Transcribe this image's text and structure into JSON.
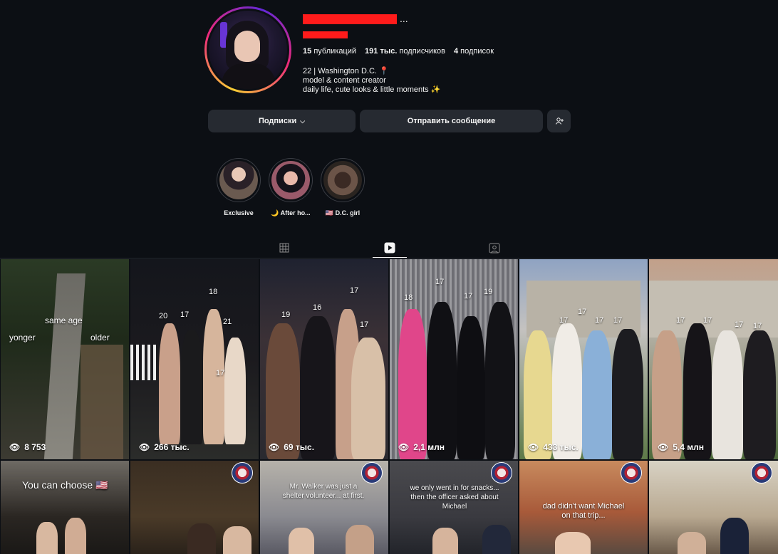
{
  "profile": {
    "username_suffix": "...",
    "stats": {
      "posts_count": "15",
      "posts_label": "публикаций",
      "followers_count": "191 тыс.",
      "followers_label": "подписчиков",
      "following_count": "4",
      "following_label": "подписок"
    },
    "bio": [
      "22 | Washington D.C. 📍",
      "model & content creator",
      "daily life, cute looks & little moments ✨"
    ]
  },
  "buttons": {
    "following_label": "Подписки",
    "message_label": "Отправить сообщение"
  },
  "highlights": [
    {
      "label": "Exclusive"
    },
    {
      "label": "🌙 After ho..."
    },
    {
      "label": "🇺🇸 D.C. girl"
    }
  ],
  "tabs": [
    {
      "name": "posts",
      "icon": "grid-icon"
    },
    {
      "name": "reels",
      "icon": "reels-icon",
      "active": true
    },
    {
      "name": "tagged",
      "icon": "tagged-icon"
    }
  ],
  "tiles": [
    {
      "views": "8 753",
      "captions": [
        "same age",
        "yonger",
        "older"
      ]
    },
    {
      "views": "266 тыс.",
      "captions": [
        "20",
        "17",
        "18",
        "21",
        "17"
      ]
    },
    {
      "views": "69 тыс.",
      "captions": [
        "19",
        "16",
        "17",
        "17"
      ]
    },
    {
      "views": "2,1 млн",
      "captions": [
        "18",
        "17",
        "17",
        "19"
      ]
    },
    {
      "views": "433 тыс.",
      "captions": [
        "17",
        "17",
        "17",
        "17"
      ]
    },
    {
      "views": "5,4 млн",
      "captions": [
        "17",
        "17",
        "17",
        "17"
      ]
    },
    {
      "captions": [
        "You can choose 🇺🇸"
      ]
    },
    {
      "captions": []
    },
    {
      "captions": [
        "Mr. Walker was just a shelter volunteer... at first."
      ]
    },
    {
      "captions": [
        "we only went in for snacks... then the officer asked about Michael"
      ]
    },
    {
      "captions": [
        "dad didn't want Michael on that trip..."
      ]
    },
    {
      "captions": []
    }
  ]
}
